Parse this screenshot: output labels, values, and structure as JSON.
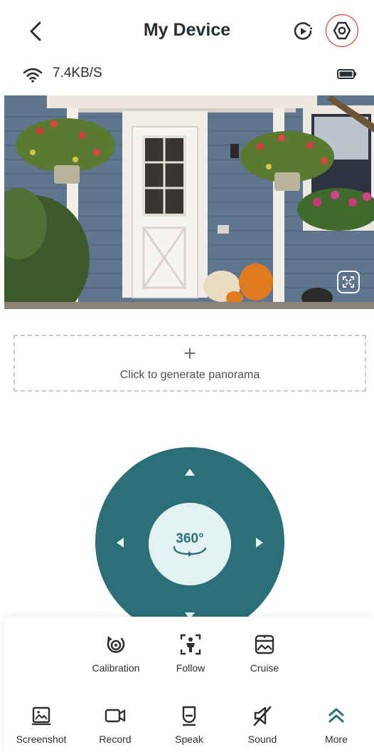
{
  "header": {
    "title": "My Device",
    "back_icon": "chevron-left-icon",
    "playback_icon": "playback-icon",
    "settings_icon": "settings-hexagon-icon"
  },
  "status": {
    "speed": "7.4KB/S",
    "wifi_icon": "wifi-icon",
    "battery_icon": "battery-icon"
  },
  "video": {
    "description_icon": "live-camera-feed",
    "fullscreen_icon": "fullscreen-icon"
  },
  "panorama": {
    "plus": "+",
    "label": "Click to generate panorama"
  },
  "ptz": {
    "center_label": "360°",
    "color": "#2b6f78",
    "center_color": "#e4f1f3"
  },
  "tools_row1": [
    {
      "label": "Calibration",
      "icon": "calibration-icon"
    },
    {
      "label": "Follow",
      "icon": "follow-person-icon"
    },
    {
      "label": "Cruise",
      "icon": "cruise-icon"
    }
  ],
  "tools_row2": [
    {
      "label": "Screenshot",
      "icon": "screenshot-icon"
    },
    {
      "label": "Record",
      "icon": "record-icon"
    },
    {
      "label": "Speak",
      "icon": "speak-icon"
    },
    {
      "label": "Sound",
      "icon": "sound-off-icon"
    },
    {
      "label": "More",
      "icon": "more-chevron-up-icon"
    }
  ],
  "colors": {
    "accent": "#2b6f78",
    "highlight_ring": "#e02a2a",
    "text": "#2a2f33"
  }
}
